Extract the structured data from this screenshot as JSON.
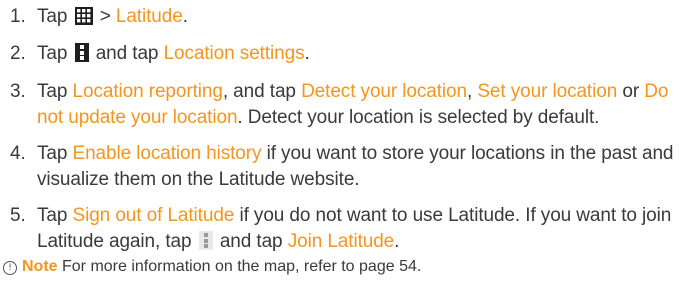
{
  "steps": [
    {
      "num": "1.",
      "parts": [
        {
          "text": "Tap "
        },
        {
          "icon": "apps-grid-icon"
        },
        {
          "text": " > "
        },
        {
          "text": "Latitude",
          "highlight": true
        },
        {
          "text": "."
        }
      ]
    },
    {
      "num": "2.",
      "parts": [
        {
          "text": "Tap "
        },
        {
          "icon": "menu-icon"
        },
        {
          "text": " and tap "
        },
        {
          "text": "Location settings",
          "highlight": true
        },
        {
          "text": "."
        }
      ]
    },
    {
      "num": "3.",
      "parts": [
        {
          "text": "Tap "
        },
        {
          "text": "Location reporting",
          "highlight": true
        },
        {
          "text": ", and tap "
        },
        {
          "text": "Detect your location",
          "highlight": true
        },
        {
          "text": ", "
        },
        {
          "text": "Set your location",
          "highlight": true
        },
        {
          "text": " or "
        },
        {
          "text": "Do not update your location",
          "highlight": true
        },
        {
          "text": ". Detect your location is selected by default."
        }
      ]
    },
    {
      "num": "4.",
      "parts": [
        {
          "text": "Tap "
        },
        {
          "text": "Enable location history",
          "highlight": true
        },
        {
          "text": " if you want to store your locations in the past and visualize them on the Latitude website."
        }
      ]
    },
    {
      "num": "5.",
      "parts": [
        {
          "text": "Tap "
        },
        {
          "text": "Sign out of Latitude",
          "highlight": true
        },
        {
          "text": " if you do not want to use Latitude. If you want to join Latitude again, tap "
        },
        {
          "icon": "menu-icon-light"
        },
        {
          "text": " and tap "
        },
        {
          "text": "Join Latitude",
          "highlight": true
        },
        {
          "text": "."
        }
      ]
    }
  ],
  "note": {
    "icon_glyph": "!",
    "label": "Note",
    "text": " For more information on the map, refer to page 54."
  },
  "colors": {
    "highlight": "#f7941d",
    "text": "#3a3a3a"
  }
}
